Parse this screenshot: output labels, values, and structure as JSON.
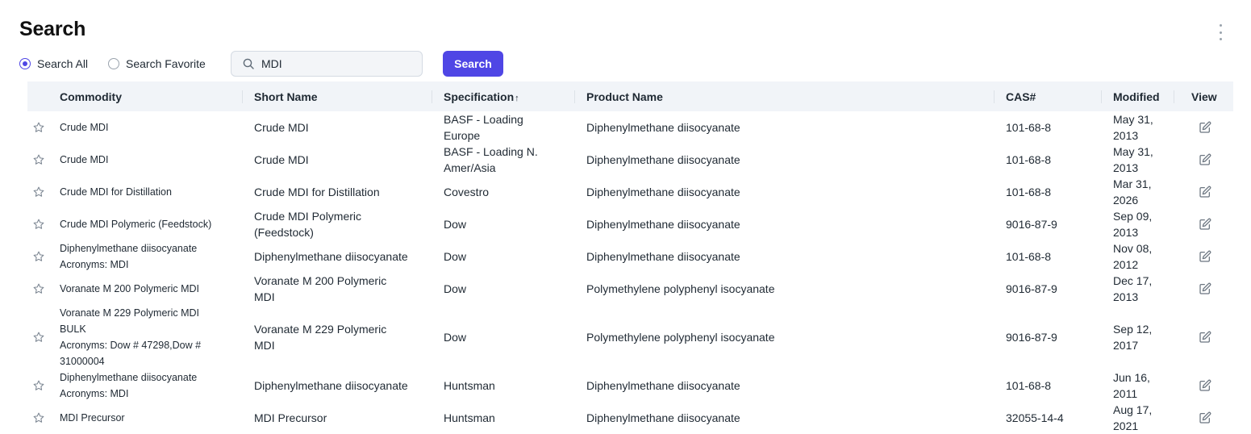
{
  "page": {
    "title": "Search"
  },
  "filters": {
    "options": [
      {
        "label": "Search All",
        "checked": true
      },
      {
        "label": "Search Favorite",
        "checked": false
      }
    ],
    "search_value": "MDI",
    "search_button": "Search"
  },
  "table": {
    "columns": [
      "Commodity",
      "Short Name",
      "Specification",
      "Product Name",
      "CAS#",
      "Modified",
      "View"
    ],
    "sort_indicator": "↑",
    "rows": [
      {
        "commodity": [
          "Crude MDI"
        ],
        "short_name": [
          "Crude MDI"
        ],
        "specification": [
          "BASF - Loading",
          "Europe"
        ],
        "product_name": "Diphenylmethane diisocyanate",
        "cas": "101-68-8",
        "modified": [
          "May 31,",
          "2013"
        ]
      },
      {
        "commodity": [
          "Crude MDI"
        ],
        "short_name": [
          "Crude MDI"
        ],
        "specification": [
          "BASF - Loading N.",
          "Amer/Asia"
        ],
        "product_name": "Diphenylmethane diisocyanate",
        "cas": "101-68-8",
        "modified": [
          "May 31,",
          "2013"
        ]
      },
      {
        "commodity": [
          "Crude MDI for Distillation"
        ],
        "short_name": [
          "Crude MDI for Distillation"
        ],
        "specification": [
          "Covestro"
        ],
        "product_name": "Diphenylmethane diisocyanate",
        "cas": "101-68-8",
        "modified": [
          "Mar 31,",
          "2026"
        ]
      },
      {
        "commodity": [
          "Crude MDI Polymeric (Feedstock)"
        ],
        "short_name": [
          "Crude MDI Polymeric",
          "(Feedstock)"
        ],
        "specification": [
          "Dow"
        ],
        "product_name": "Diphenylmethane diisocyanate",
        "cas": "9016-87-9",
        "modified": [
          "Sep 09,",
          "2013"
        ]
      },
      {
        "commodity": [
          "Diphenylmethane diisocyanate",
          "Acronyms: MDI"
        ],
        "short_name": [
          "Diphenylmethane diisocyanate"
        ],
        "specification": [
          "Dow"
        ],
        "product_name": "Diphenylmethane diisocyanate",
        "cas": "101-68-8",
        "modified": [
          "Nov 08,",
          "2012"
        ]
      },
      {
        "commodity": [
          "Voranate M 200 Polymeric MDI"
        ],
        "short_name": [
          "Voranate M 200 Polymeric",
          "MDI"
        ],
        "specification": [
          "Dow"
        ],
        "product_name": "Polymethylene polyphenyl isocyanate",
        "cas": "9016-87-9",
        "modified": [
          "Dec 17,",
          "2013"
        ]
      },
      {
        "commodity": [
          "Voranate M 229 Polymeric MDI",
          "BULK",
          "Acronyms: Dow # 47298,Dow #",
          "31000004"
        ],
        "short_name": [
          "Voranate M 229 Polymeric",
          "MDI"
        ],
        "specification": [
          "Dow"
        ],
        "product_name": "Polymethylene polyphenyl isocyanate",
        "cas": "9016-87-9",
        "modified": [
          "Sep 12,",
          "2017"
        ]
      },
      {
        "commodity": [
          "Diphenylmethane diisocyanate",
          "Acronyms: MDI"
        ],
        "short_name": [
          "Diphenylmethane diisocyanate"
        ],
        "specification": [
          "Huntsman"
        ],
        "product_name": "Diphenylmethane diisocyanate",
        "cas": "101-68-8",
        "modified": [
          "Jun 16,",
          "2011"
        ]
      },
      {
        "commodity": [
          "MDI Precursor"
        ],
        "short_name": [
          "MDI Precursor"
        ],
        "specification": [
          "Huntsman"
        ],
        "product_name": "Diphenylmethane diisocyanate",
        "cas": "32055-14-4",
        "modified": [
          "Aug 17,",
          "2021"
        ]
      }
    ]
  },
  "icons": {
    "menu": "more-vertical-icon",
    "search": "search-icon",
    "favorite": "star-icon",
    "view": "edit-icon",
    "sort": "arrow-up-icon"
  },
  "colors": {
    "accent": "#4f46e5",
    "header_bg": "#f1f4f8",
    "icon_gray": "#7d8793"
  }
}
